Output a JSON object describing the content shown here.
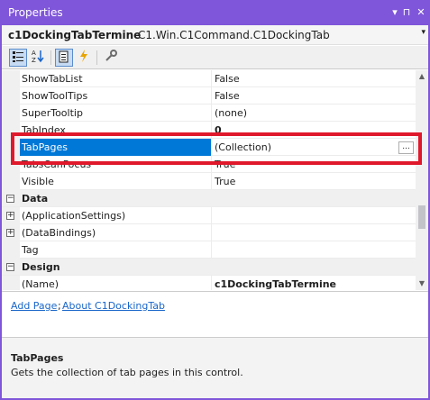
{
  "window": {
    "title": "Properties",
    "buttons": {
      "dropdown": "▾",
      "pin": "⊓",
      "close": "✕"
    }
  },
  "object_selector": {
    "name": "c1DockingTabTermine",
    "type": "C1.Win.C1Command.C1DockingTab",
    "dropdown": "▾"
  },
  "toolbar": {
    "icons": [
      "categorized-icon",
      "alphabetical-icon",
      "properties-icon",
      "events-icon",
      "property-pages-icon"
    ]
  },
  "grid": {
    "rows": [
      {
        "name": "ShowTabList",
        "value": "False"
      },
      {
        "name": "ShowToolTips",
        "value": "False"
      },
      {
        "name": "SuperTooltip",
        "value": "(none)"
      },
      {
        "name": "TabIndex",
        "value": "0"
      },
      {
        "name": "TabPages",
        "value": "(Collection)",
        "ellipsis": "..."
      },
      {
        "name": "TabsCanFocus",
        "value": "True"
      },
      {
        "name": "Visible",
        "value": "True"
      }
    ],
    "categories": {
      "data": {
        "label": "Data",
        "toggle": "−",
        "items": [
          {
            "name": "(ApplicationSettings)",
            "toggle": "+"
          },
          {
            "name": "(DataBindings)",
            "toggle": "+"
          },
          {
            "name": "Tag",
            "value": ""
          }
        ]
      },
      "design": {
        "label": "Design",
        "toggle": "−",
        "items": [
          {
            "name": "(Name)",
            "value": "c1DockingTabTermine"
          }
        ]
      }
    }
  },
  "commands": {
    "links": [
      "Add Page",
      "About C1DockingTab"
    ],
    "separator": ";"
  },
  "description": {
    "title": "TabPages",
    "text": "Gets the collection of tab pages in this control."
  },
  "colors": {
    "titlebar": "#7f56d9",
    "selection": "#0078d7",
    "highlight": "#e0182b",
    "link": "#1a66c9"
  }
}
